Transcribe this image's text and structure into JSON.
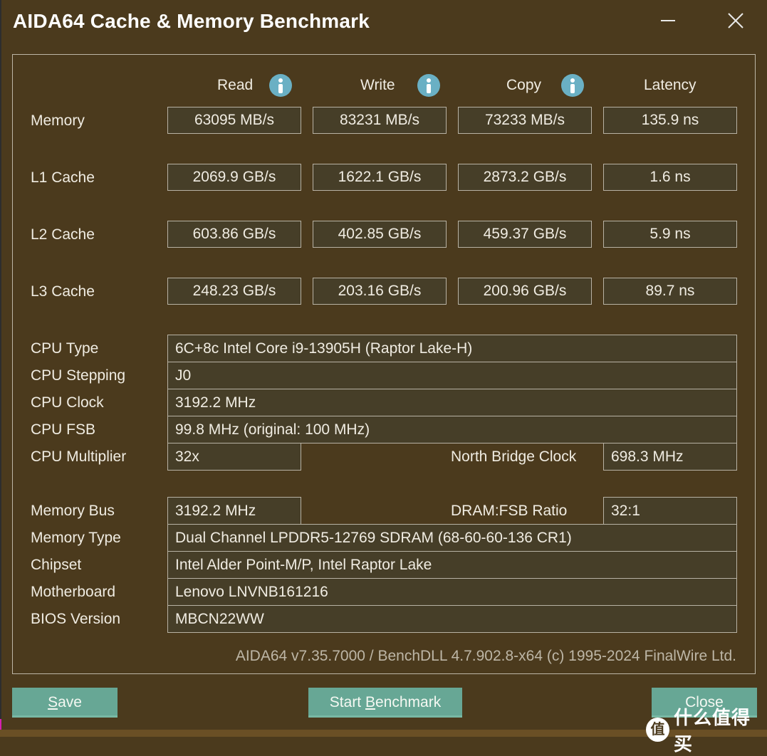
{
  "window": {
    "title": "AIDA64 Cache & Memory Benchmark"
  },
  "columns": {
    "read": "Read",
    "write": "Write",
    "copy": "Copy",
    "latency": "Latency"
  },
  "benchmarks": [
    {
      "label": "Memory",
      "read": "63095 MB/s",
      "write": "83231 MB/s",
      "copy": "73233 MB/s",
      "latency": "135.9 ns"
    },
    {
      "label": "L1 Cache",
      "read": "2069.9 GB/s",
      "write": "1622.1 GB/s",
      "copy": "2873.2 GB/s",
      "latency": "1.6 ns"
    },
    {
      "label": "L2 Cache",
      "read": "603.86 GB/s",
      "write": "402.85 GB/s",
      "copy": "459.37 GB/s",
      "latency": "5.9 ns"
    },
    {
      "label": "L3 Cache",
      "read": "248.23 GB/s",
      "write": "203.16 GB/s",
      "copy": "200.96 GB/s",
      "latency": "89.7 ns"
    }
  ],
  "cpu": {
    "type_label": "CPU Type",
    "type": "6C+8c Intel Core i9-13905H  (Raptor Lake-H)",
    "stepping_label": "CPU Stepping",
    "stepping": "J0",
    "clock_label": "CPU Clock",
    "clock": "3192.2 MHz",
    "fsb_label": "CPU FSB",
    "fsb": "99.8 MHz  (original: 100 MHz)",
    "multiplier_label": "CPU Multiplier",
    "multiplier": "32x",
    "nb_clock_label": "North Bridge Clock",
    "nb_clock": "698.3 MHz"
  },
  "memory": {
    "bus_label": "Memory Bus",
    "bus": "3192.2 MHz",
    "ratio_label": "DRAM:FSB Ratio",
    "ratio": "32:1",
    "type_label": "Memory Type",
    "type": "Dual Channel LPDDR5-12769 SDRAM  (68-60-60-136 CR1)",
    "chipset_label": "Chipset",
    "chipset": "Intel Alder Point-M/P, Intel Raptor Lake",
    "motherboard_label": "Motherboard",
    "motherboard": "Lenovo LNVNB161216",
    "bios_label": "BIOS Version",
    "bios": "MBCN22WW"
  },
  "footer": {
    "version": "AIDA64 v7.35.7000 / BenchDLL 4.7.902.8-x64  (c) 1995-2024 FinalWire Ltd."
  },
  "buttons": {
    "save_mnemonic": "S",
    "save_rest": "ave",
    "start_pre": "Start ",
    "start_mnemonic": "B",
    "start_rest": "enchmark",
    "close": "Close"
  },
  "watermark": {
    "badge": "值",
    "text": "什么值得买"
  },
  "colors": {
    "background": "#4b3a1d",
    "value_box": "#463e28",
    "button": "#67a795",
    "info_icon": "#6ab0c4"
  }
}
